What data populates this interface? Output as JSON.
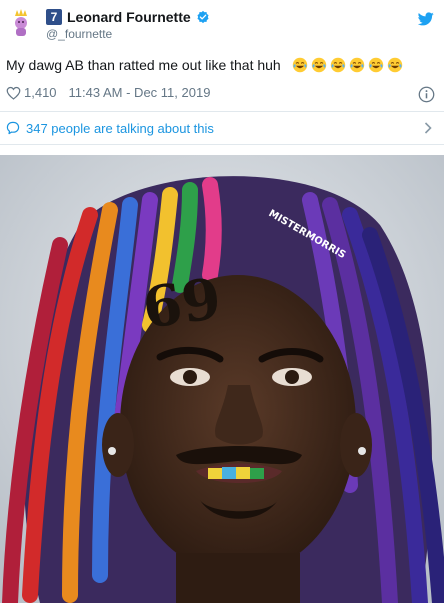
{
  "tweet": {
    "jersey_number": "7",
    "display_name": "Leonard Fournette",
    "handle": "@_fournette",
    "text": "My dawg AB than ratted me out like that huh",
    "emoji_count": 6,
    "emoji_name": "face-with-tears-of-joy",
    "likes": "1,410",
    "timestamp": "11:43 AM - Dec 11, 2019",
    "talking": "347 people are talking about this"
  },
  "photo": {
    "watermark": "MISTERMORRIS",
    "face_tattoo_number": "69",
    "description_colors": {
      "accent": "#1da1f2",
      "link": "#1b95e0",
      "muted": "#657786"
    }
  }
}
